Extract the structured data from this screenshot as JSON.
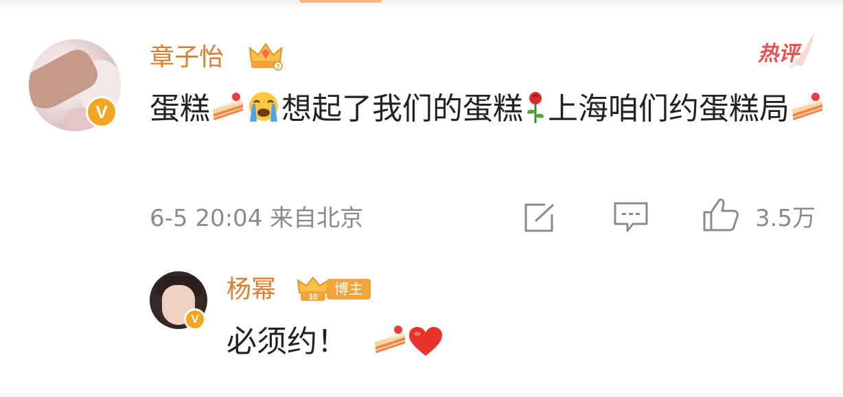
{
  "main_comment": {
    "username": "章子怡",
    "hot_label": "热评",
    "text_parts": [
      "蛋糕",
      "想起了我们的蛋糕",
      "上海咱们约蛋糕局"
    ],
    "emoji_sequence": [
      "cake-slice-icon",
      "loudly-crying-face-icon",
      "rose-icon",
      "cake-slice-icon"
    ],
    "timestamp": "6-5 20:04",
    "location": "来自北京",
    "like_count": "3.5万"
  },
  "reply": {
    "username": "杨幂",
    "badge_label": "博主",
    "badge_level": "10",
    "text": "必须约！",
    "emoji_sequence": [
      "cake-slice-icon",
      "red-heart-icon"
    ]
  },
  "colors": {
    "username": "#e07c2c",
    "hot_label": "#ee4d4d",
    "meta": "#8a8a8a",
    "verified_badge": "#f4a623",
    "blogger_badge": "#f2a33a"
  }
}
